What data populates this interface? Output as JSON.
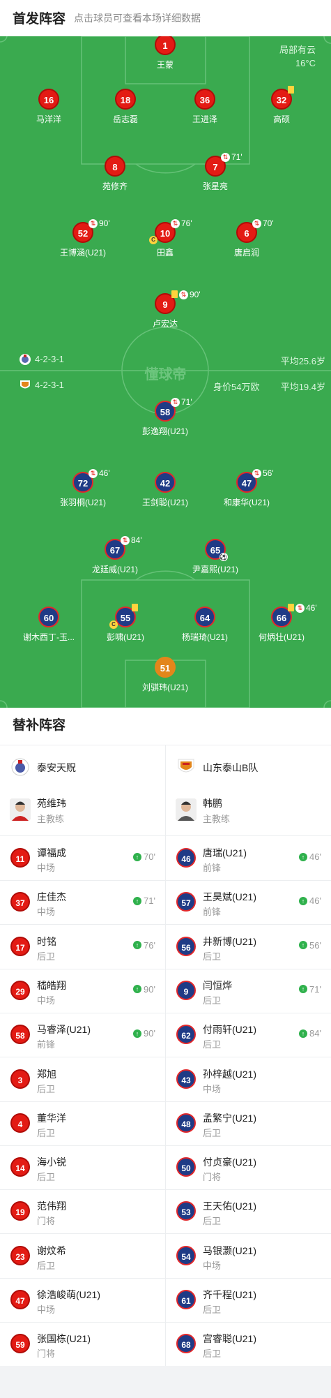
{
  "header": {
    "title": "首发阵容",
    "subtitle": "点击球员可查看本场详细数据"
  },
  "field": {
    "weather": "局部有云",
    "temperature": "16°C",
    "watermark": "懂球帝",
    "home_formation": "4-2-3-1",
    "home_avg_age": "平均25.6岁",
    "away_formation": "4-2-3-1",
    "away_value": "身价54万欧",
    "away_avg_age": "平均19.4岁"
  },
  "home_lineup": [
    {
      "num": "1",
      "name": "王蒙"
    },
    {
      "num": "16",
      "name": "马洋洋"
    },
    {
      "num": "18",
      "name": "岳志磊"
    },
    {
      "num": "36",
      "name": "王进泽"
    },
    {
      "num": "32",
      "name": "高硕",
      "yellow": true
    },
    {
      "num": "8",
      "name": "苑修齐"
    },
    {
      "num": "7",
      "name": "张星亮",
      "sub": "71'"
    },
    {
      "num": "52",
      "name": "王博涵(U21)",
      "sub": "90'"
    },
    {
      "num": "10",
      "name": "田鑫",
      "sub": "76'",
      "captain": "C"
    },
    {
      "num": "6",
      "name": "唐启润",
      "sub": "70'"
    },
    {
      "num": "9",
      "name": "卢宏达",
      "sub": "90'",
      "yellow": true
    }
  ],
  "away_lineup": [
    {
      "num": "58",
      "name": "彭逸翔(U21)",
      "sub": "71'"
    },
    {
      "num": "72",
      "name": "张羽桐(U21)",
      "sub": "46'"
    },
    {
      "num": "42",
      "name": "王剑聪(U21)"
    },
    {
      "num": "47",
      "name": "和康华(U21)",
      "sub": "56'"
    },
    {
      "num": "67",
      "name": "龙廷威(U21)",
      "sub": "84'"
    },
    {
      "num": "65",
      "name": "尹嘉熙(U21)",
      "goal": "⚽"
    },
    {
      "num": "60",
      "name": "谢木西丁-玉..."
    },
    {
      "num": "55",
      "name": "彭啸(U21)",
      "yellow": true,
      "captain": "C"
    },
    {
      "num": "64",
      "name": "杨瑞琦(U21)"
    },
    {
      "num": "66",
      "name": "何炳壮(U21)",
      "sub": "46'",
      "yellow": true
    },
    {
      "num": "51",
      "name": "刘骐玮(U21)"
    }
  ],
  "subs_section": {
    "title": "替补阵容",
    "home": {
      "team": "泰安天贶",
      "coach": "苑维玮",
      "coach_role": "主教练",
      "players": [
        {
          "num": "11",
          "name": "谭福成",
          "pos": "中场",
          "on": "70'"
        },
        {
          "num": "37",
          "name": "庄佳杰",
          "pos": "中场",
          "on": "71'"
        },
        {
          "num": "17",
          "name": "时铭",
          "pos": "后卫",
          "on": "76'"
        },
        {
          "num": "29",
          "name": "嵇皓翔",
          "pos": "中场",
          "on": "90'"
        },
        {
          "num": "58",
          "name": "马睿泽(U21)",
          "pos": "前锋",
          "on": "90'"
        },
        {
          "num": "3",
          "name": "郑旭",
          "pos": "后卫"
        },
        {
          "num": "4",
          "name": "董华洋",
          "pos": "后卫"
        },
        {
          "num": "14",
          "name": "海小锐",
          "pos": "后卫"
        },
        {
          "num": "19",
          "name": "范伟翔",
          "pos": "门将"
        },
        {
          "num": "23",
          "name": "谢炆希",
          "pos": "后卫"
        },
        {
          "num": "47",
          "name": "徐浩峻萌(U21)",
          "pos": "中场"
        },
        {
          "num": "59",
          "name": "张国栋(U21)",
          "pos": "门将"
        }
      ]
    },
    "away": {
      "team": "山东泰山B队",
      "coach": "韩鹏",
      "coach_role": "主教练",
      "players": [
        {
          "num": "46",
          "name": "唐瑞(U21)",
          "pos": "前锋",
          "on": "46'"
        },
        {
          "num": "57",
          "name": "王昊斌(U21)",
          "pos": "前锋",
          "on": "46'"
        },
        {
          "num": "56",
          "name": "井新博(U21)",
          "pos": "后卫",
          "on": "56'"
        },
        {
          "num": "9",
          "name": "闫恒烨",
          "pos": "后卫",
          "on": "71'"
        },
        {
          "num": "62",
          "name": "付雨轩(U21)",
          "pos": "后卫",
          "on": "84'"
        },
        {
          "num": "43",
          "name": "孙梓越(U21)",
          "pos": "中场"
        },
        {
          "num": "48",
          "name": "孟繁宁(U21)",
          "pos": "后卫"
        },
        {
          "num": "50",
          "name": "付贞豪(U21)",
          "pos": "门将"
        },
        {
          "num": "53",
          "name": "王天佑(U21)",
          "pos": "后卫"
        },
        {
          "num": "54",
          "name": "马银灏(U21)",
          "pos": "中场"
        },
        {
          "num": "61",
          "name": "齐千程(U21)",
          "pos": "后卫"
        },
        {
          "num": "68",
          "name": "宫睿聪(U21)",
          "pos": "后卫"
        }
      ]
    }
  },
  "colors": {
    "pitch": "#3aaa4f",
    "home": "#e31b14",
    "away": "#1f3b86",
    "sub_in": "#2fb14c"
  }
}
